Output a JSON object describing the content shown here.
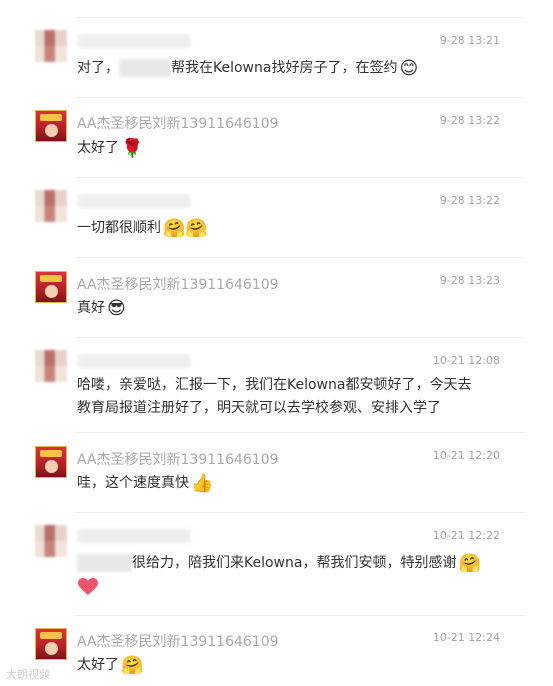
{
  "colors": {
    "name": "#a9a9a9",
    "time": "#a3a3a3",
    "text": "#333333",
    "divider": "#ececec"
  },
  "messages": [
    {
      "avatar": "blurred-avatar",
      "name": "",
      "time": "9-28 13:21",
      "text_before": "对了，",
      "text_after": "帮我在Kelowna找好房子了，在签约",
      "emoji": "😊"
    },
    {
      "avatar": "photo-avatar",
      "name": "AA杰圣移民刘新13911646109",
      "time": "9-28 13:22",
      "text": "太好了",
      "emoji": "🌹"
    },
    {
      "avatar": "blurred-avatar",
      "name": "",
      "time": "9-28 13:22",
      "text": "一切都很顺利",
      "emoji": "🤗🤗"
    },
    {
      "avatar": "photo-avatar",
      "name": "AA杰圣移民刘新13911646109",
      "time": "9-28 13:23",
      "text": "真好",
      "emoji": "😎"
    },
    {
      "avatar": "blurred-avatar",
      "name": "",
      "time": "10-21 12:08",
      "line1": "哈喽，亲爱哒，汇报一下，我们在Kelowna都安顿好了，今天去",
      "line2": "教育局报道注册好了，明天就可以去学校参观、安排入学了"
    },
    {
      "avatar": "photo-avatar",
      "name": "AA杰圣移民刘新13911646109",
      "time": "10-21 12:20",
      "text": "哇，这个速度真快",
      "emoji": "👍"
    },
    {
      "avatar": "blurred-avatar",
      "name": "",
      "time": "10-21 12:22",
      "text_after": "很给力，陪我们来Kelowna，帮我们安顿，特别感谢",
      "emoji": "🤗",
      "emoji2": "❤️"
    },
    {
      "avatar": "photo-avatar",
      "name": "AA杰圣移民刘新13911646109",
      "time": "10-21 12:24",
      "text": "太好了",
      "emoji": "🤗"
    }
  ],
  "watermark": "大朗视频"
}
